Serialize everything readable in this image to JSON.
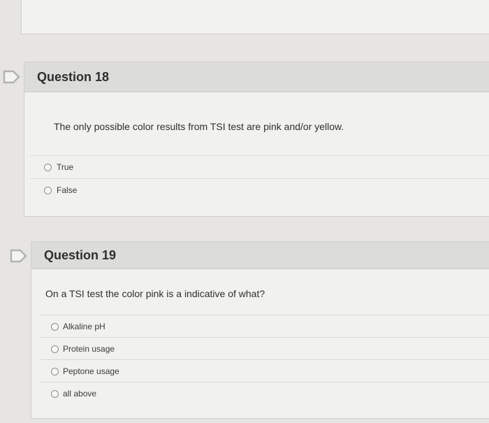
{
  "questions": [
    {
      "title": "Question 18",
      "text": "The only possible color results from TSI test are pink and/or yellow.",
      "options": [
        "True",
        "False"
      ]
    },
    {
      "title": "Question 19",
      "text": "On a TSI test the color pink is a indicative of what?",
      "options": [
        "Alkaline pH",
        "Protein usage",
        "Peptone usage",
        "all above"
      ]
    }
  ],
  "icons": {
    "question_marker": "flag-icon"
  },
  "colors": {
    "background": "#e6e5e3",
    "card": "#f1f1ef",
    "header": "#dcdcda",
    "marker": "#b4b4b2"
  }
}
